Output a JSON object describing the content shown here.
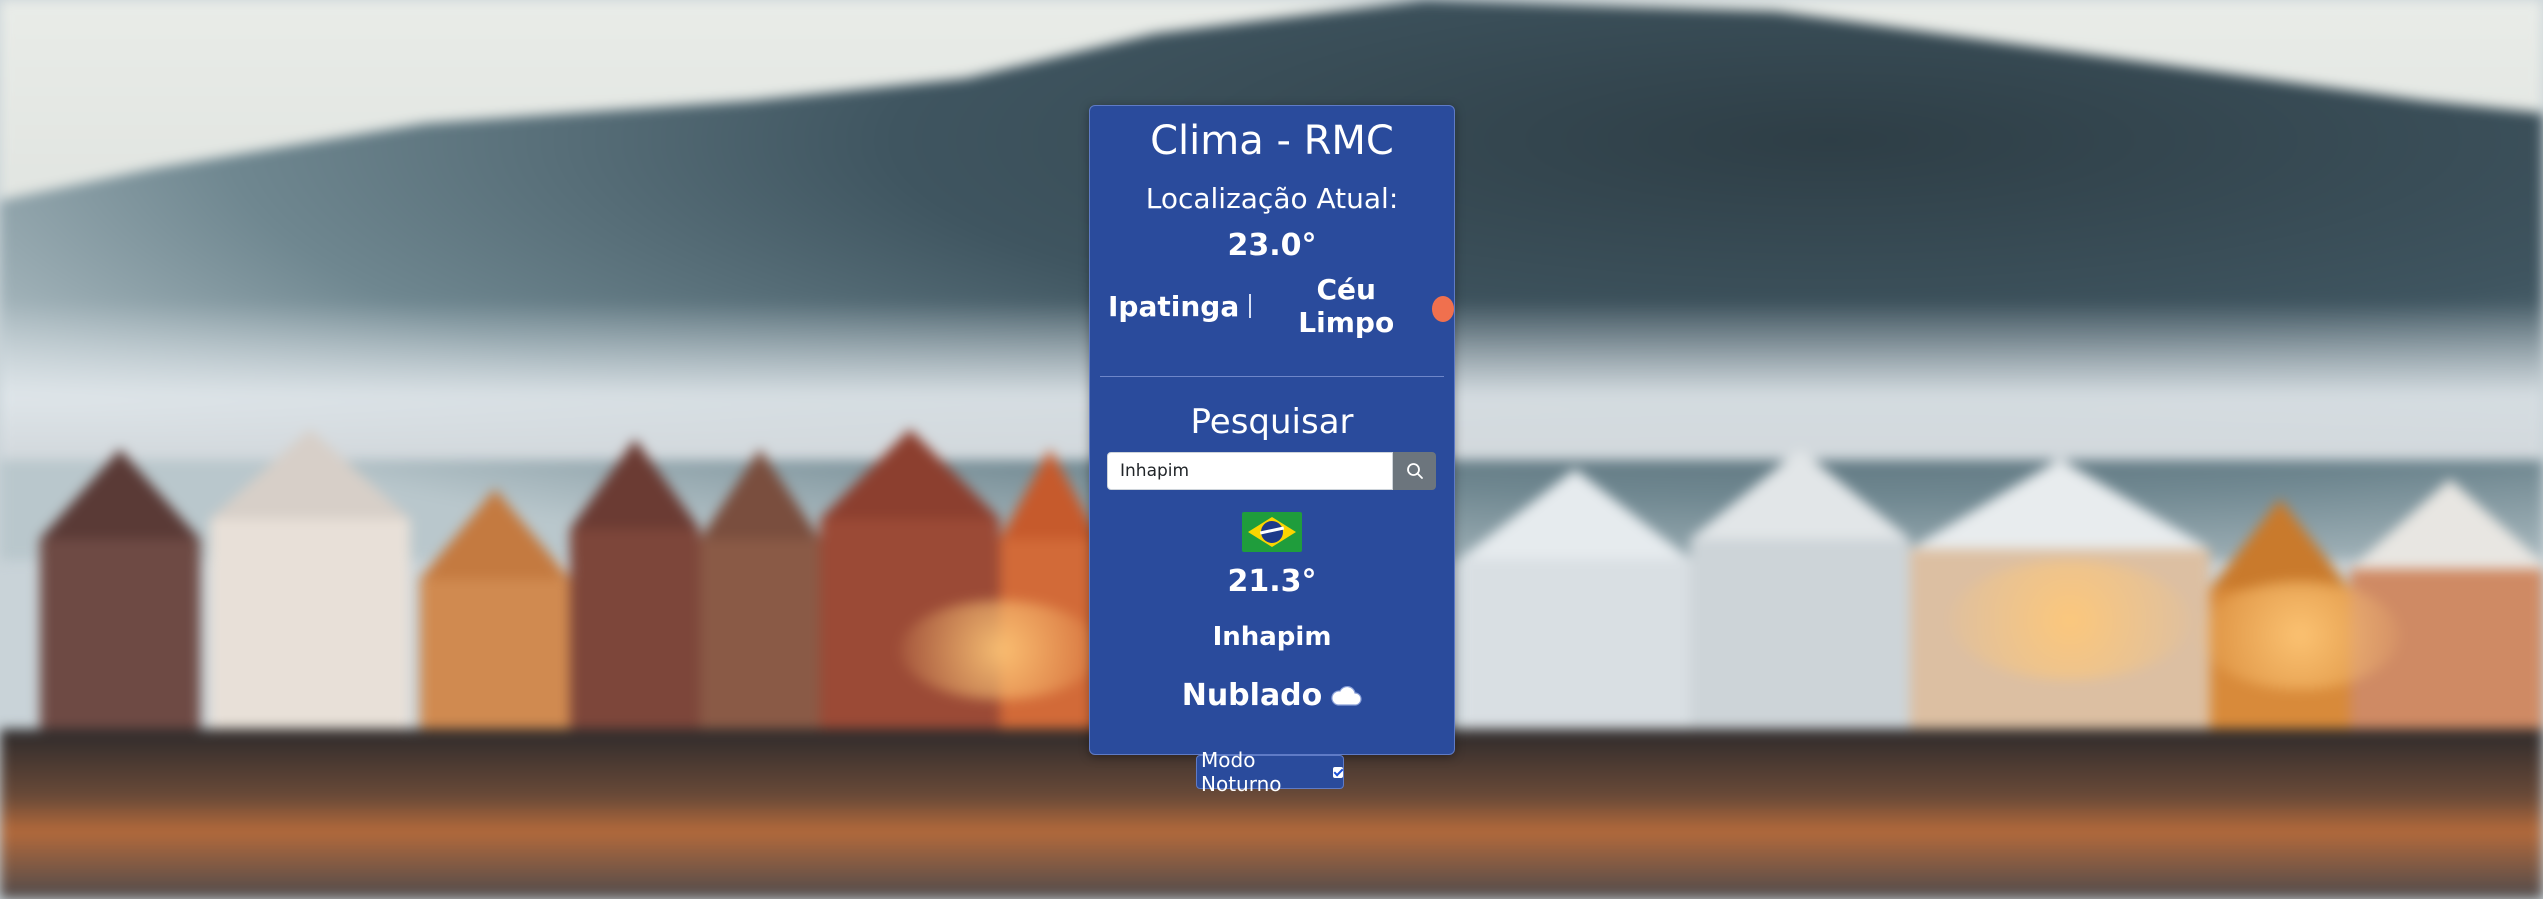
{
  "app": {
    "title": "Clima - RMC"
  },
  "current": {
    "label": "Localização Atual:",
    "temperature": "23.0°",
    "city": "Ipatinga",
    "condition": "Céu Limpo",
    "condition_icon": "sun-icon",
    "condition_icon_color": "#f0704e"
  },
  "search": {
    "title": "Pesquisar",
    "input_value": "Inhapim",
    "button_icon": "search-icon"
  },
  "result": {
    "flag": "brazil-flag",
    "temperature": "21.3°",
    "city": "Inhapim",
    "condition": "Nublado",
    "condition_icon": "cloud-icon"
  },
  "night_mode": {
    "label": "Modo Noturno",
    "checked": true
  },
  "colors": {
    "card_bg": "#2a4b9c",
    "card_border": "#5f7bc6",
    "search_button": "#6c757d"
  }
}
